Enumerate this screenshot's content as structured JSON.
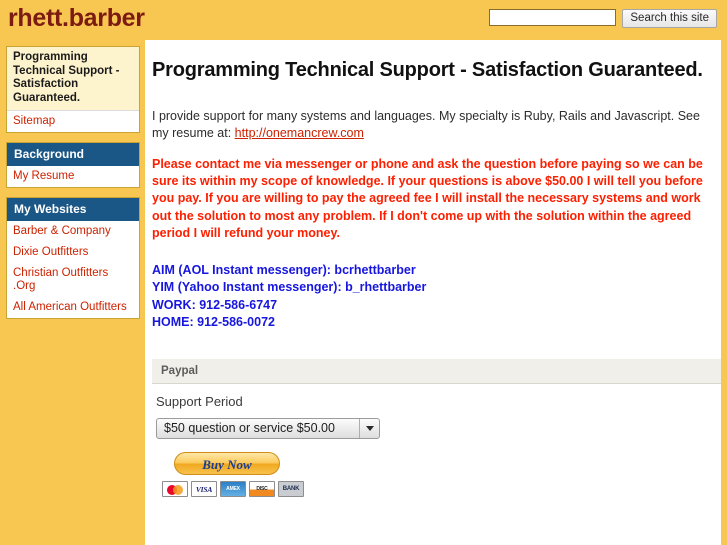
{
  "header": {
    "site_title": "rhett.barber",
    "search_placeholder": "",
    "search_value": "",
    "search_button_label": "Search this site"
  },
  "sidebar": {
    "groups": [
      {
        "current_page": "Programming Technical Support - Satisfaction Guaranteed.",
        "links": [
          {
            "label": "Sitemap"
          }
        ]
      },
      {
        "section_title": "Background",
        "links": [
          {
            "label": "My Resume"
          }
        ]
      },
      {
        "section_title": "My Websites",
        "links": [
          {
            "label": "Barber & Company"
          },
          {
            "label": "Dixie Outfitters"
          },
          {
            "label": "Christian Outfitters .Org"
          },
          {
            "label": "All American Outfitters"
          }
        ]
      }
    ]
  },
  "main": {
    "page_title": "Programming Technical Support - Satisfaction Guaranteed.",
    "intro_before_link": "I provide support for many systems and languages. My specialty is Ruby, Rails and Javascript. See my resume at: ",
    "intro_link": "http://onemancrew.com",
    "notice": "Please contact me via messenger or phone and ask the question before paying so we can be sure its within my scope of knowledge. If your questions is above $50.00 I will tell you before you pay. If you are willing to pay the agreed fee I will install the necessary systems and work out the solution to most any problem. If I don't come up with the solution within the agreed period I will refund your money.",
    "contact_lines": [
      "AIM (AOL Instant messenger): bcrhettbarber",
      "YIM (Yahoo Instant messenger): b_rhettbarber",
      "WORK: 912-586-6747",
      "HOME: 912-586-0072"
    ]
  },
  "paypal": {
    "panel_title": "Paypal",
    "field_label": "Support Period",
    "selected_option": "$50 question or service $50.00",
    "buy_now_label": "Buy Now",
    "cards": [
      "MasterCard",
      "VISA",
      "American Express",
      "Discover",
      "BANK"
    ],
    "card_short_labels": [
      "",
      "VISA",
      "AMEX",
      "DISC",
      "BANK"
    ]
  },
  "colors": {
    "band": "#f7c752",
    "title": "#7b1b12",
    "section_header": "#1a5786",
    "link": "#cc2200",
    "notice": "#fe1f00",
    "contact": "#1616e0"
  }
}
